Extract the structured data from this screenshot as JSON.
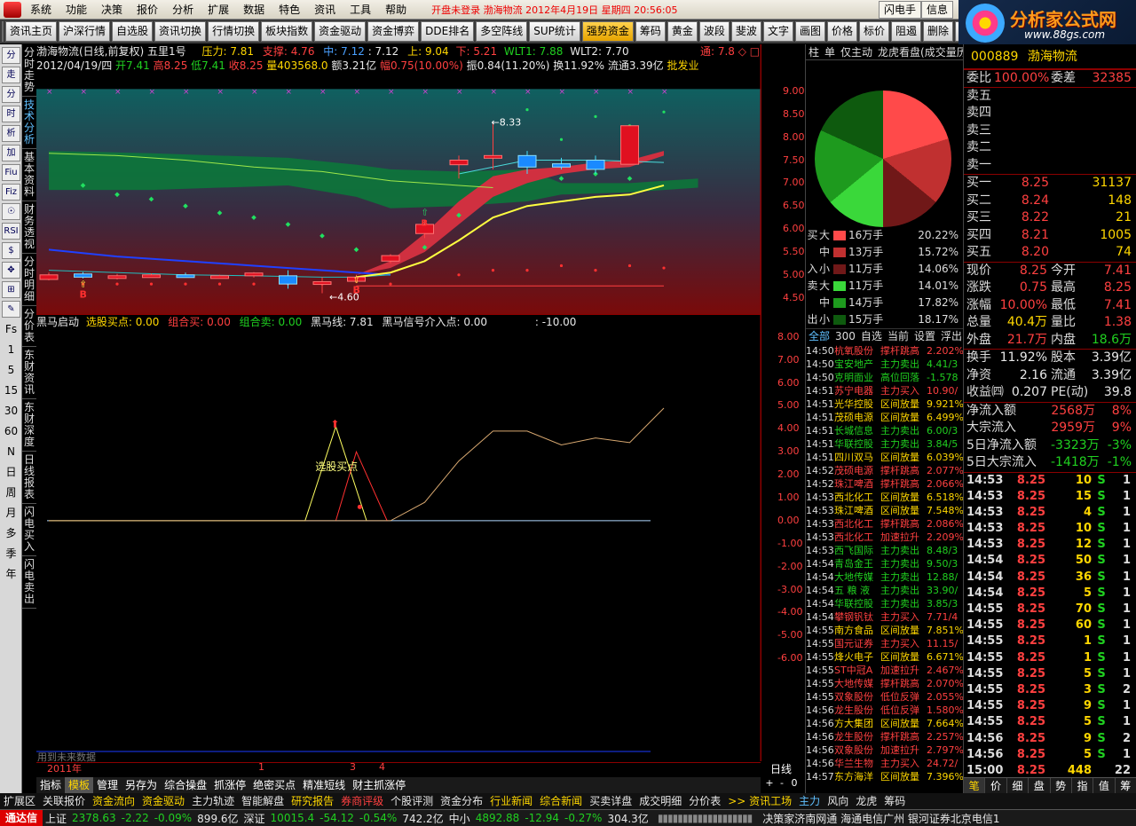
{
  "menu": {
    "items": [
      "系统",
      "功能",
      "决策",
      "报价",
      "分析",
      "扩展",
      "数据",
      "特色",
      "资讯",
      "工具",
      "帮助"
    ],
    "ticker": "开盘未登录  渤海物流  2012年4月19日 星期四  20:56:05",
    "flash_btn": "闪电手",
    "info_btn": "信息"
  },
  "brand": {
    "title": "分析家公式网",
    "url": "www.88gs.com"
  },
  "toolbar": [
    "资讯主页",
    "沪深行情",
    "自选股",
    "资讯切换",
    "行情切换",
    "板块指数",
    "资金驱动",
    "资金博弈",
    "DDE排名",
    "多空阵线",
    "SUP统计",
    "强势资金",
    "筹码",
    "黄金",
    "波段",
    "斐波",
    "文字",
    "画图",
    "价格",
    "标价",
    "阻遏",
    "删除",
    "01"
  ],
  "toolbar_active": "强势资金",
  "left_tools": [
    "分",
    "走",
    "分",
    "时",
    "析",
    "加",
    "Fiu",
    "Fiz",
    "☉",
    "RSI",
    "$",
    "✥",
    "⊞",
    "✎"
  ],
  "left_periods": [
    "Fs",
    "1",
    "5",
    "15",
    "30",
    "60",
    "N",
    "日",
    "周",
    "月",
    "多",
    "季",
    "年"
  ],
  "vtabs": [
    {
      "label": "分时走势"
    },
    {
      "label": "技术分析",
      "on": true
    },
    {
      "label": "基本资料"
    },
    {
      "label": "财务透视"
    },
    {
      "label": "分时明细"
    },
    {
      "label": "分价表"
    },
    {
      "label": "东财资讯"
    },
    {
      "label": "东财深度"
    },
    {
      "label": "日线报表"
    },
    {
      "label": "闪电买入"
    },
    {
      "label": "闪电卖出"
    }
  ],
  "chart": {
    "header1": {
      "name": "渤海物流(日线,前复权) 五里1号",
      "p1": "压力: 7.81",
      "p2": "支撑: 4.76",
      "p3": "中: 7.12",
      "p4": ": 7.12",
      "p5": "上: 9.04",
      "p6": "下: 5.21",
      "p7": "WLT1: 7.88",
      "p8": "WLT2: 7.70",
      "badge": "通: 7.8 ◇ □"
    },
    "header2": {
      "date": "2012/04/19/四",
      "open": "开7.41",
      "high": "高8.25",
      "low": "低7.41",
      "close": "收8.25",
      "vol": "量403568.0",
      "amt": "额3.21亿",
      "chg": "幅0.75(10.00%)",
      "amp": "振0.84(11.20%)",
      "turn": "换11.92%",
      "float": "流通3.39亿",
      "sector": "批发业"
    },
    "lowest_label": "4.60",
    "highest_label": "8.33",
    "ind_header": {
      "name": "黑马启动",
      "a": "选股买点: 0.00",
      "b": "组合买: 0.00",
      "c": "组合卖: 0.00",
      "d": "黑马线: 7.81",
      "e": "黑马信号介入点: 0.00",
      "f": ": -10.00"
    },
    "ind_label": "选股买点",
    "bottom_note": "用到未来数据",
    "year_label": "2011年",
    "month_labels": [
      "1",
      "3",
      "4"
    ],
    "period_label": "日线",
    "zoom": [
      "+",
      "-",
      "0"
    ],
    "price_axis": [
      "9.00",
      "8.50",
      "8.00",
      "7.50",
      "7.00",
      "6.50",
      "6.00",
      "5.50",
      "5.00",
      "4.50"
    ],
    "ind_axis": [
      "8.00",
      "7.00",
      "6.00",
      "5.00",
      "4.00",
      "3.00",
      "2.00",
      "1.00",
      "0.00",
      "-1.00",
      "-2.00",
      "-3.00",
      "-4.00",
      "-5.00",
      "-6.00"
    ]
  },
  "chart_data": {
    "type": "candlestick",
    "candles": [
      [
        4.9,
        5.05,
        4.88,
        5.0
      ],
      [
        5.02,
        5.06,
        4.92,
        4.95
      ],
      [
        4.95,
        5.02,
        4.9,
        4.98
      ],
      [
        4.98,
        5.03,
        4.95,
        5.0
      ],
      [
        5.0,
        5.05,
        4.95,
        4.97
      ],
      [
        4.97,
        5.0,
        4.93,
        4.98
      ],
      [
        4.98,
        5.06,
        4.94,
        5.04
      ],
      [
        4.98,
        5.1,
        4.7,
        4.8
      ],
      [
        4.82,
        4.95,
        4.6,
        4.85
      ],
      [
        4.86,
        5.0,
        4.82,
        4.95
      ],
      [
        5.3,
        5.45,
        5.25,
        5.42
      ],
      [
        5.9,
        6.2,
        5.8,
        6.1
      ],
      [
        7.4,
        7.6,
        7.1,
        7.5
      ],
      [
        7.55,
        8.33,
        7.3,
        7.6
      ],
      [
        7.6,
        7.7,
        7.2,
        7.35
      ],
      [
        7.42,
        7.55,
        7.3,
        7.35
      ],
      [
        7.5,
        7.6,
        7.2,
        7.3
      ],
      [
        7.41,
        8.25,
        7.41,
        8.25
      ]
    ],
    "ind_line": [
      [
        0,
        0
      ],
      [
        10,
        0
      ],
      [
        11,
        0.8
      ],
      [
        12,
        2.6
      ],
      [
        13,
        3.9
      ],
      [
        14,
        3.9
      ],
      [
        15,
        3.3
      ],
      [
        16,
        3.6
      ],
      [
        17,
        3.4
      ],
      [
        18,
        4.9
      ]
    ],
    "ind_low": 0,
    "ind_top": 7.8
  },
  "right_tabs": [
    "柱",
    "单",
    "仅主动",
    "龙虎看盘(成交量历"
  ],
  "flow": [
    {
      "side": "买",
      "size": "大",
      "color": "#ff4a4a",
      "hands": "16万手",
      "pct": "20.22%"
    },
    {
      "side": "",
      "size": "中",
      "color": "#c03030",
      "hands": "13万手",
      "pct": "15.72%"
    },
    {
      "side": "入",
      "size": "小",
      "color": "#701818",
      "hands": "11万手",
      "pct": "14.06%"
    },
    {
      "side": "卖",
      "size": "大",
      "color": "#3ad83a",
      "hands": "11万手",
      "pct": "14.01%"
    },
    {
      "side": "",
      "size": "中",
      "color": "#1e9a1e",
      "hands": "14万手",
      "pct": "17.82%"
    },
    {
      "side": "出",
      "size": "小",
      "color": "#0e5a0e",
      "hands": "15万手",
      "pct": "18.17%"
    }
  ],
  "news_tabs": [
    "全部",
    "300",
    "自选",
    "当前",
    "设置",
    "浮出",
    "拉"
  ],
  "news": [
    {
      "t": "14:50",
      "s": "杭氧股份",
      "e": "撑杆跳高",
      "v": "2.202%",
      "c": "#ff4040"
    },
    {
      "t": "14:50",
      "s": "宝安地产",
      "e": "主力卖出",
      "v": "4.41/3",
      "c": "#20d020"
    },
    {
      "t": "14:50",
      "s": "克明面业",
      "e": "高位回落",
      "v": "-1.578",
      "c": "#20d020"
    },
    {
      "t": "14:51",
      "s": "苏宁电器",
      "e": "主力买入",
      "v": "10.90/",
      "c": "#ff4040"
    },
    {
      "t": "14:51",
      "s": "光华控股",
      "e": "区间放量",
      "v": "9.921%",
      "c": "#ffd700"
    },
    {
      "t": "14:51",
      "s": "茂硕电源",
      "e": "区间放量",
      "v": "6.499%",
      "c": "#ffd700"
    },
    {
      "t": "14:51",
      "s": "长城信息",
      "e": "主力卖出",
      "v": "6.00/3",
      "c": "#20d020"
    },
    {
      "t": "14:51",
      "s": "华联控股",
      "e": "主力卖出",
      "v": "3.84/5",
      "c": "#20d020"
    },
    {
      "t": "14:51",
      "s": "四川双马",
      "e": "区间放量",
      "v": "6.039%",
      "c": "#ffd700"
    },
    {
      "t": "14:52",
      "s": "茂硕电源",
      "e": "撑杆跳高",
      "v": "2.077%",
      "c": "#ff4040"
    },
    {
      "t": "14:52",
      "s": "珠江啤酒",
      "e": "撑杆跳高",
      "v": "2.066%",
      "c": "#ff4040"
    },
    {
      "t": "14:53",
      "s": "西北化工",
      "e": "区间放量",
      "v": "6.518%",
      "c": "#ffd700"
    },
    {
      "t": "14:53",
      "s": "珠江啤酒",
      "e": "区间放量",
      "v": "7.548%",
      "c": "#ffd700"
    },
    {
      "t": "14:53",
      "s": "西北化工",
      "e": "撑杆跳高",
      "v": "2.086%",
      "c": "#ff4040"
    },
    {
      "t": "14:53",
      "s": "西北化工",
      "e": "加速拉升",
      "v": "2.209%",
      "c": "#ff4040"
    },
    {
      "t": "14:53",
      "s": "西飞国际",
      "e": "主力卖出",
      "v": "8.48/3",
      "c": "#20d020"
    },
    {
      "t": "14:54",
      "s": "青岛金王",
      "e": "主力卖出",
      "v": "9.50/3",
      "c": "#20d020"
    },
    {
      "t": "14:54",
      "s": "大地传媒",
      "e": "主力卖出",
      "v": "12.88/",
      "c": "#20d020"
    },
    {
      "t": "14:54",
      "s": "五 粮 液",
      "e": "主力卖出",
      "v": "33.90/",
      "c": "#20d020"
    },
    {
      "t": "14:54",
      "s": "华联控股",
      "e": "主力卖出",
      "v": "3.85/3",
      "c": "#20d020"
    },
    {
      "t": "14:54",
      "s": "攀钢钒钛",
      "e": "主力买入",
      "v": "7.71/4",
      "c": "#ff4040"
    },
    {
      "t": "14:55",
      "s": "南方食品",
      "e": "区间放量",
      "v": "7.851%",
      "c": "#ffd700"
    },
    {
      "t": "14:55",
      "s": "国元证券",
      "e": "主力买入",
      "v": "11.15/",
      "c": "#ff4040"
    },
    {
      "t": "14:55",
      "s": "烽火电子",
      "e": "区间放量",
      "v": "6.671%",
      "c": "#ffd700"
    },
    {
      "t": "14:55",
      "s": "ST中冠A",
      "e": "加速拉升",
      "v": "2.467%",
      "c": "#ff4040"
    },
    {
      "t": "14:55",
      "s": "大地传媒",
      "e": "撑杆跳高",
      "v": "2.070%",
      "c": "#ff4040"
    },
    {
      "t": "14:55",
      "s": "双象股份",
      "e": "低位反弹",
      "v": "2.055%",
      "c": "#ff4040"
    },
    {
      "t": "14:56",
      "s": "龙生股份",
      "e": "低位反弹",
      "v": "1.580%",
      "c": "#ff4040"
    },
    {
      "t": "14:56",
      "s": "方大集团",
      "e": "区间放量",
      "v": "7.664%",
      "c": "#ffd700"
    },
    {
      "t": "14:56",
      "s": "龙生股份",
      "e": "撑杆跳高",
      "v": "2.257%",
      "c": "#ff4040"
    },
    {
      "t": "14:56",
      "s": "双象股份",
      "e": "加速拉升",
      "v": "2.797%",
      "c": "#ff4040"
    },
    {
      "t": "14:56",
      "s": "华兰生物",
      "e": "主力买入",
      "v": "24.72/",
      "c": "#ff4040"
    },
    {
      "t": "14:57",
      "s": "东方海洋",
      "e": "区间放量",
      "v": "7.396%",
      "c": "#ffd700"
    }
  ],
  "quote": {
    "code": "000889",
    "name": "渤海物流",
    "wb": {
      "l": "委比",
      "v": "100.00%",
      "l2": "委差",
      "v2": "32385"
    },
    "sells": [
      "卖五",
      "卖四",
      "卖三",
      "卖二",
      "卖一"
    ],
    "buys": [
      {
        "l": "买一",
        "p": "8.25",
        "v": "31137"
      },
      {
        "l": "买二",
        "p": "8.24",
        "v": "148"
      },
      {
        "l": "买三",
        "p": "8.22",
        "v": "21"
      },
      {
        "l": "买四",
        "p": "8.21",
        "v": "1005"
      },
      {
        "l": "买五",
        "p": "8.20",
        "v": "74"
      }
    ],
    "stats": [
      {
        "l": "现价",
        "v": "8.25",
        "c": "#ff4040",
        "l2": "今开",
        "v2": "7.41",
        "c2": "#ff4040"
      },
      {
        "l": "涨跌",
        "v": "0.75",
        "c": "#ff4040",
        "l2": "最高",
        "v2": "8.25",
        "c2": "#ff4040"
      },
      {
        "l": "涨幅",
        "v": "10.00%",
        "c": "#ff4040",
        "l2": "最低",
        "v2": "7.41",
        "c2": "#ff4040"
      },
      {
        "l": "总量",
        "v": "40.4万",
        "c": "#ffd700",
        "l2": "量比",
        "v2": "1.38",
        "c2": "#ff4040"
      },
      {
        "l": "外盘",
        "v": "21.7万",
        "c": "#ff4040",
        "l2": "内盘",
        "v2": "18.6万",
        "c2": "#20d020"
      }
    ],
    "stats2": [
      {
        "l": "换手",
        "v": "11.92%",
        "c": "#e8e8e8",
        "l2": "股本",
        "v2": "3.39亿",
        "c2": "#e8e8e8"
      },
      {
        "l": "净资",
        "v": "2.16",
        "c": "#e8e8e8",
        "l2": "流通",
        "v2": "3.39亿",
        "c2": "#e8e8e8"
      },
      {
        "l": "收益㈣",
        "v": "0.207",
        "c": "#e8e8e8",
        "l2": "PE(动)",
        "v2": "39.8",
        "c2": "#e8e8e8"
      }
    ],
    "flows": [
      {
        "l": "净流入额",
        "v": "2568万",
        "p": "8%",
        "c": "#ff4040"
      },
      {
        "l": "大宗流入",
        "v": "2959万",
        "p": "9%",
        "c": "#ff4040"
      },
      {
        "l": "5日净流入额",
        "v": "-3323万",
        "p": "-3%",
        "c": "#20d020"
      },
      {
        "l": "5日大宗流入",
        "v": "-1418万",
        "p": "-1%",
        "c": "#20d020"
      }
    ],
    "ticks": [
      {
        "t": "14:53",
        "p": "8.25",
        "v": "10",
        "s": "S",
        "n": "1"
      },
      {
        "t": "14:53",
        "p": "8.25",
        "v": "15",
        "s": "S",
        "n": "1"
      },
      {
        "t": "14:53",
        "p": "8.25",
        "v": "4",
        "s": "S",
        "n": "1"
      },
      {
        "t": "14:53",
        "p": "8.25",
        "v": "10",
        "s": "S",
        "n": "1"
      },
      {
        "t": "14:53",
        "p": "8.25",
        "v": "12",
        "s": "S",
        "n": "1"
      },
      {
        "t": "14:54",
        "p": "8.25",
        "v": "50",
        "s": "S",
        "n": "1"
      },
      {
        "t": "14:54",
        "p": "8.25",
        "v": "36",
        "s": "S",
        "n": "1"
      },
      {
        "t": "14:54",
        "p": "8.25",
        "v": "5",
        "s": "S",
        "n": "1"
      },
      {
        "t": "14:55",
        "p": "8.25",
        "v": "70",
        "s": "S",
        "n": "1"
      },
      {
        "t": "14:55",
        "p": "8.25",
        "v": "60",
        "s": "S",
        "n": "1"
      },
      {
        "t": "14:55",
        "p": "8.25",
        "v": "1",
        "s": "S",
        "n": "1"
      },
      {
        "t": "14:55",
        "p": "8.25",
        "v": "1",
        "s": "S",
        "n": "1"
      },
      {
        "t": "14:55",
        "p": "8.25",
        "v": "5",
        "s": "S",
        "n": "1"
      },
      {
        "t": "14:55",
        "p": "8.25",
        "v": "3",
        "s": "S",
        "n": "2"
      },
      {
        "t": "14:55",
        "p": "8.25",
        "v": "9",
        "s": "S",
        "n": "1"
      },
      {
        "t": "14:55",
        "p": "8.25",
        "v": "5",
        "s": "S",
        "n": "1"
      },
      {
        "t": "14:56",
        "p": "8.25",
        "v": "9",
        "s": "S",
        "n": "2"
      },
      {
        "t": "14:56",
        "p": "8.25",
        "v": "5",
        "s": "S",
        "n": "1"
      },
      {
        "t": "15:00",
        "p": "8.25",
        "v": "448",
        "s": "",
        "n": "22"
      }
    ],
    "bottom_tabs": [
      "笔",
      "价",
      "细",
      "盘",
      "势",
      "指",
      "值",
      "筹"
    ]
  },
  "bottom_tabs": [
    "指标",
    "模板",
    "管理",
    "另存为",
    "综合操盘",
    "抓涨停",
    "绝密买点",
    "精准短线",
    "财主抓涨停"
  ],
  "funcbar": [
    {
      "t": "扩展区",
      "c": "#e8e8e8"
    },
    {
      "t": "关联报价",
      "c": "#e8e8e8"
    },
    {
      "t": "资金流向",
      "c": "#ffd700"
    },
    {
      "t": "资金驱动",
      "c": "#ffd700"
    },
    {
      "t": "主力轨迹",
      "c": "#e8e8e8"
    },
    {
      "t": "智能解盘",
      "c": "#e8e8e8"
    },
    {
      "t": "研究报告",
      "c": "#ffd700"
    },
    {
      "t": "券商评级",
      "c": "#ff4040"
    },
    {
      "t": "个股评测",
      "c": "#e8e8e8"
    },
    {
      "t": "资金分布",
      "c": "#e8e8e8"
    },
    {
      "t": "行业新闻",
      "c": "#ffd700"
    },
    {
      "t": "综合新闻",
      "c": "#ffd700"
    },
    {
      "t": "买卖详盘",
      "c": "#e8e8e8"
    },
    {
      "t": "成交明细",
      "c": "#e8e8e8"
    },
    {
      "t": "分价表",
      "c": "#e8e8e8"
    },
    {
      "t": ">> 资讯工场",
      "c": "#ffd700"
    },
    {
      "t": "主力",
      "c": "#60c0ff"
    },
    {
      "t": "风向",
      "c": "#e8e8e8"
    },
    {
      "t": "龙虎",
      "c": "#e8e8e8"
    },
    {
      "t": "筹码",
      "c": "#e8e8e8"
    }
  ],
  "status": {
    "logo": "通达信",
    "sh_l": "上证",
    "sh_v": "2378.63",
    "sh_c": "-2.22",
    "sh_p": "-0.09%",
    "sh_a": "899.6亿",
    "sz_l": "深证",
    "sz_v": "10015.4",
    "sz_c": "-54.12",
    "sz_p": "-0.54%",
    "sz_a": "742.2亿",
    "zx_l": "中小",
    "zx_v": "4892.88",
    "zx_c": "-12.94",
    "zx_p": "-0.27%",
    "zx_a": "304.3亿",
    "srv": "决策家济南网通 海通电信广州 银河证券北京电信1"
  }
}
